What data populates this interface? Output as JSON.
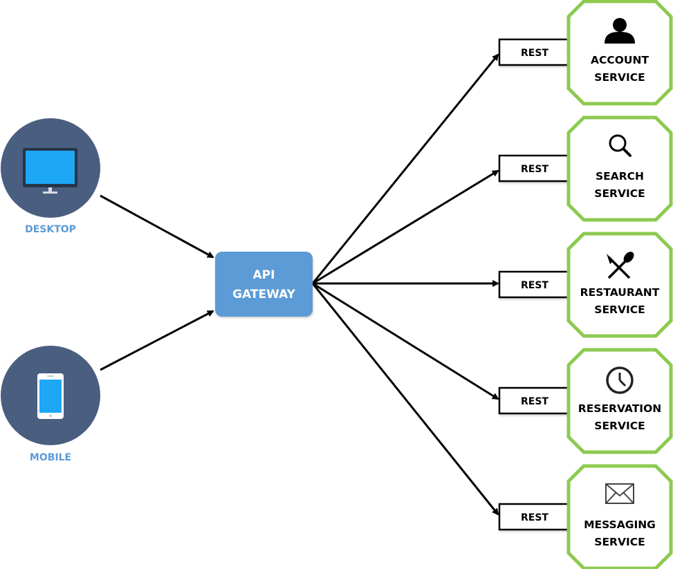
{
  "colors": {
    "client_circle": "#4a5e80",
    "client_label": "#5b9bd5",
    "screen_blue": "#1ea7f5",
    "gateway_fill": "#5b9bd5",
    "service_border": "#8cca50",
    "arrow": "#000000"
  },
  "clients": [
    {
      "id": "desktop",
      "label": "DESKTOP",
      "icon": "desktop-monitor-icon"
    },
    {
      "id": "mobile",
      "label": "MOBILE",
      "icon": "mobile-phone-icon"
    }
  ],
  "gateway": {
    "line1": "API",
    "line2": "GATEWAY"
  },
  "services": [
    {
      "id": "account",
      "protocol": "REST",
      "line1": "ACCOUNT",
      "line2": "SERVICE",
      "icon": "user-icon"
    },
    {
      "id": "search",
      "protocol": "REST",
      "line1": "SEARCH",
      "line2": "SERVICE",
      "icon": "search-icon"
    },
    {
      "id": "restaurant",
      "protocol": "REST",
      "line1": "RESTAURANT",
      "line2": "SERVICE",
      "icon": "utensils-icon"
    },
    {
      "id": "reservation",
      "protocol": "REST",
      "line1": "RESERVATION",
      "line2": "SERVICE",
      "icon": "clock-icon"
    },
    {
      "id": "messaging",
      "protocol": "REST",
      "line1": "MESSAGING",
      "line2": "SERVICE",
      "icon": "envelope-icon"
    }
  ],
  "edges": [
    {
      "from": "desktop",
      "to": "gateway"
    },
    {
      "from": "mobile",
      "to": "gateway"
    },
    {
      "from": "gateway",
      "to": "account"
    },
    {
      "from": "gateway",
      "to": "search"
    },
    {
      "from": "gateway",
      "to": "restaurant"
    },
    {
      "from": "gateway",
      "to": "reservation"
    },
    {
      "from": "gateway",
      "to": "messaging"
    }
  ]
}
